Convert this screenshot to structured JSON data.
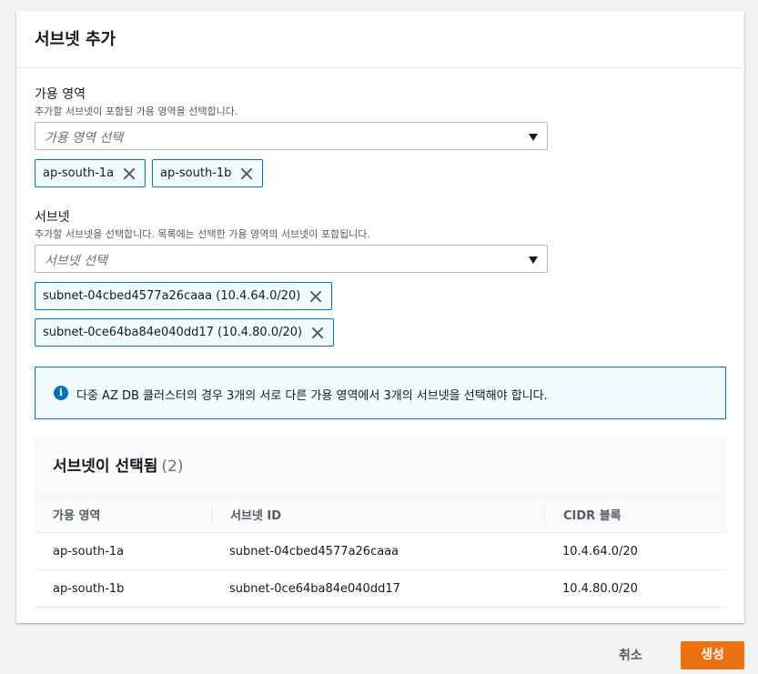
{
  "panel": {
    "title": "서브넷 추가"
  },
  "az_field": {
    "label": "가용 영역",
    "description": "추가할 서브넷이 포함된 가용 영역을 선택합니다.",
    "placeholder": "가용 영역 선택",
    "tokens": [
      "ap-south-1a",
      "ap-south-1b"
    ]
  },
  "subnet_field": {
    "label": "서브넷",
    "description": "추가할 서브넷을 선택합니다. 목록에는 선택한 가용 영역의 서브넷이 포함됩니다.",
    "placeholder": "서브넷 선택",
    "tokens": [
      "subnet-04cbed4577a26caaa (10.4.64.0/20)",
      "subnet-0ce64ba84e040dd17 (10.4.80.0/20)"
    ]
  },
  "info": {
    "icon": "info-icon",
    "text": "다중 AZ DB 클러스터의 경우 3개의 서로 다른 가용 영역에서 3개의 서브넷을 선택해야 합니다."
  },
  "selected_table": {
    "title": "서브넷이 선택됨",
    "count": "(2)",
    "columns": [
      "가용 영역",
      "서브넷 ID",
      "CIDR 블록"
    ],
    "rows": [
      [
        "ap-south-1a",
        "subnet-04cbed4577a26caaa",
        "10.4.64.0/20"
      ],
      [
        "ap-south-1b",
        "subnet-0ce64ba84e040dd17",
        "10.4.80.0/20"
      ]
    ]
  },
  "footer": {
    "cancel_label": "취소",
    "create_label": "생성"
  },
  "colors": {
    "accent": "#0073bb",
    "primary_button": "#ec7211"
  }
}
